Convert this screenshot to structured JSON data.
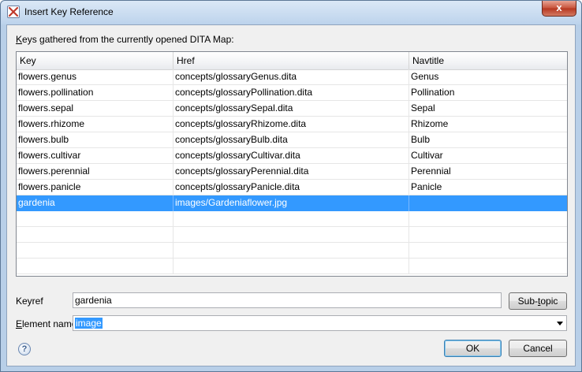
{
  "window": {
    "title": "Insert Key Reference",
    "close_glyph": "x"
  },
  "intro": {
    "prefix": "K",
    "rest": "eys gathered from the currently opened DITA Map:"
  },
  "table": {
    "columns": [
      "Key",
      "Href",
      "Navtitle"
    ],
    "rows": [
      {
        "key": "flowers.genus",
        "href": "concepts/glossaryGenus.dita",
        "navtitle": "Genus"
      },
      {
        "key": "flowers.pollination",
        "href": "concepts/glossaryPollination.dita",
        "navtitle": "Pollination"
      },
      {
        "key": "flowers.sepal",
        "href": "concepts/glossarySepal.dita",
        "navtitle": "Sepal"
      },
      {
        "key": "flowers.rhizome",
        "href": "concepts/glossaryRhizome.dita",
        "navtitle": "Rhizome"
      },
      {
        "key": "flowers.bulb",
        "href": "concepts/glossaryBulb.dita",
        "navtitle": "Bulb"
      },
      {
        "key": "flowers.cultivar",
        "href": "concepts/glossaryCultivar.dita",
        "navtitle": "Cultivar"
      },
      {
        "key": "flowers.perennial",
        "href": "concepts/glossaryPerennial.dita",
        "navtitle": "Perennial"
      },
      {
        "key": "flowers.panicle",
        "href": "concepts/glossaryPanicle.dita",
        "navtitle": "Panicle"
      },
      {
        "key": "gardenia",
        "href": "images/Gardeniaflower.jpg",
        "navtitle": ""
      }
    ],
    "selected_index": 8
  },
  "keyref": {
    "label": "Keyref",
    "value": "gardenia",
    "subtopic_prefix": "Sub-",
    "subtopic_underlined": "t",
    "subtopic_rest": "opic"
  },
  "element_name": {
    "label_prefix": "E",
    "label_rest": "lement name",
    "value": "image"
  },
  "buttons": {
    "ok": "OK",
    "cancel": "Cancel",
    "help_glyph": "?"
  },
  "colors": {
    "selection": "#3399ff",
    "frame": "#b8cfe8",
    "close": "#c7523a"
  }
}
